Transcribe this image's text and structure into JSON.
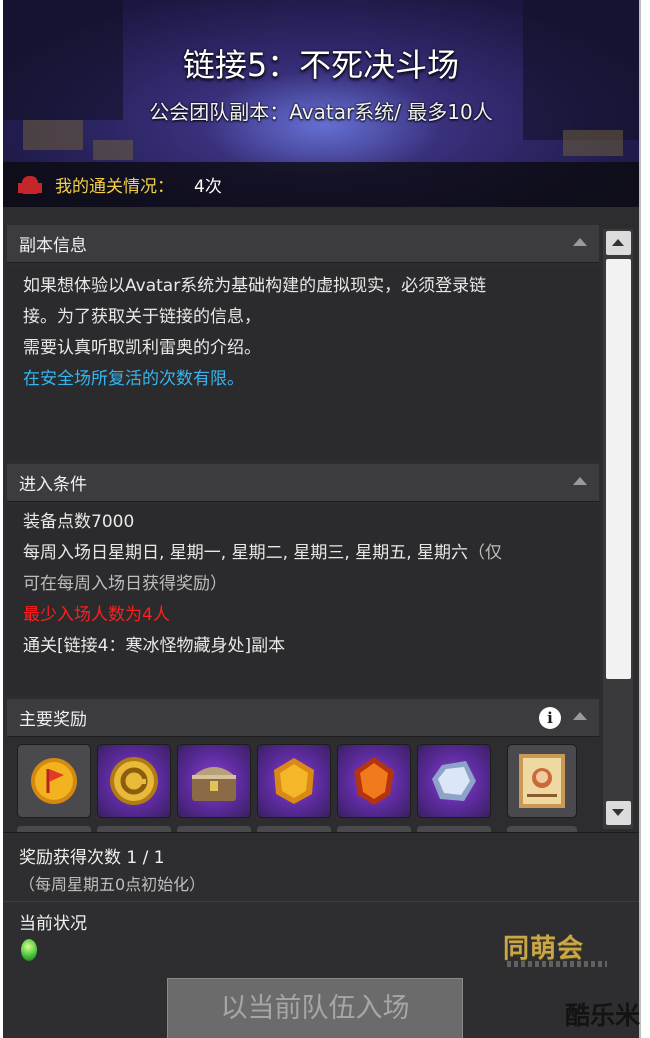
{
  "header": {
    "title": "链接5：不死决斗场",
    "subtitle": "公会团队副本：Avatar系统/ 最多10人",
    "clear_label": "我的通关情况：",
    "clear_value": "4次"
  },
  "sections": {
    "info": {
      "title": "副本信息",
      "lines": [
        "如果想体验以Avatar系统为基础构建的虚拟现实，必须登录链",
        "接。为了获取关于链接的信息，",
        "需要认真听取凯利雷奥的介绍。"
      ],
      "highlight": "在安全场所复活的次数有限。"
    },
    "conditions": {
      "title": "进入条件",
      "gear": "装备点数7000",
      "days_line1": "每周入场日星期日, 星期一, 星期二, 星期三, 星期五, 星期六",
      "days_note1": "（仅",
      "days_note2": "可在每周入场日获得奖励）",
      "min_players": "最少入场人数为4人",
      "prereq": "通关[链接4：寒冰怪物藏身处]副本"
    },
    "rewards": {
      "title": "主要奖励",
      "items": [
        "flag-coin-icon",
        "gold-coin-icon",
        "treasure-chest-icon",
        "gold-gem-icon",
        "orange-gem-icon",
        "crystal-icon",
        "wanted-poster-icon"
      ]
    }
  },
  "footer": {
    "reward_count": "奖励获得次数 1 / 1",
    "reset_note": "（每周星期五0点初始化）",
    "status_label": "当前状况",
    "enter_button": "以当前队伍入场"
  },
  "watermarks": {
    "logo": "同萌会",
    "corner": "酷乐米"
  },
  "colors": {
    "highlight_blue": "#35b6f0",
    "warning_red": "#ff1f1f",
    "gold_label": "#f3cf4a",
    "purple_slot": "#8a3fd0"
  }
}
